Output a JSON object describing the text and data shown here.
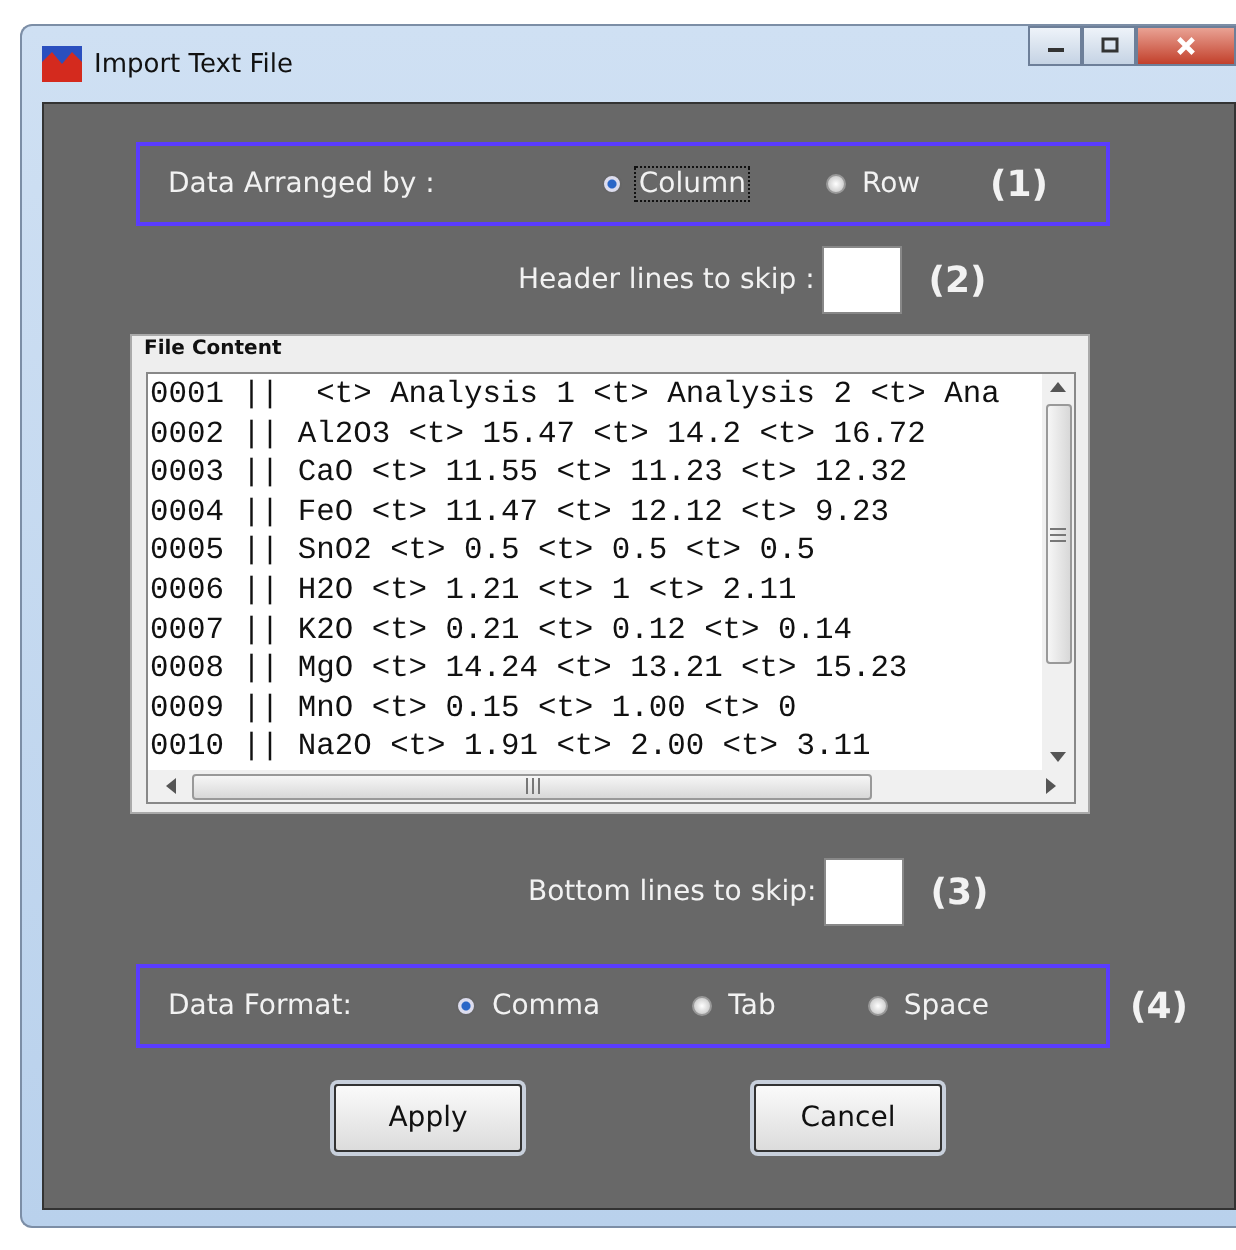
{
  "window": {
    "title": "Import Text File"
  },
  "arranged_by": {
    "label": "Data Arranged by :",
    "marker": "(1)",
    "options": [
      {
        "label": "Column",
        "selected": true,
        "focused": true
      },
      {
        "label": "Row",
        "selected": false,
        "focused": false
      }
    ]
  },
  "header_skip": {
    "label": "Header lines to skip :",
    "marker": "(2)"
  },
  "file_content": {
    "title": "File Content",
    "lines": [
      "0001 ||  <t> Analysis 1 <t> Analysis 2 <t> Ana",
      "0002 || Al2O3 <t> 15.47 <t> 14.2 <t> 16.72",
      "0003 || CaO <t> 11.55 <t> 11.23 <t> 12.32",
      "0004 || FeO <t> 11.47 <t> 12.12 <t> 9.23",
      "0005 || SnO2 <t> 0.5 <t> 0.5 <t> 0.5",
      "0006 || H2O <t> 1.21 <t> 1 <t> 2.11",
      "0007 || K2O <t> 0.21 <t> 0.12 <t> 0.14",
      "0008 || MgO <t> 14.24 <t> 13.21 <t> 15.23",
      "0009 || MnO <t> 0.15 <t> 1.00 <t> 0",
      "0010 || Na2O <t> 1.91 <t> 2.00 <t> 3.11"
    ]
  },
  "bottom_skip": {
    "label": "Bottom lines to skip:",
    "marker": "(3)"
  },
  "data_format": {
    "label": "Data Format:",
    "marker": "(4)",
    "options": [
      {
        "label": "Comma",
        "selected": true
      },
      {
        "label": "Tab",
        "selected": false
      },
      {
        "label": "Space",
        "selected": false
      }
    ]
  },
  "buttons": [
    "Apply",
    "Cancel"
  ]
}
